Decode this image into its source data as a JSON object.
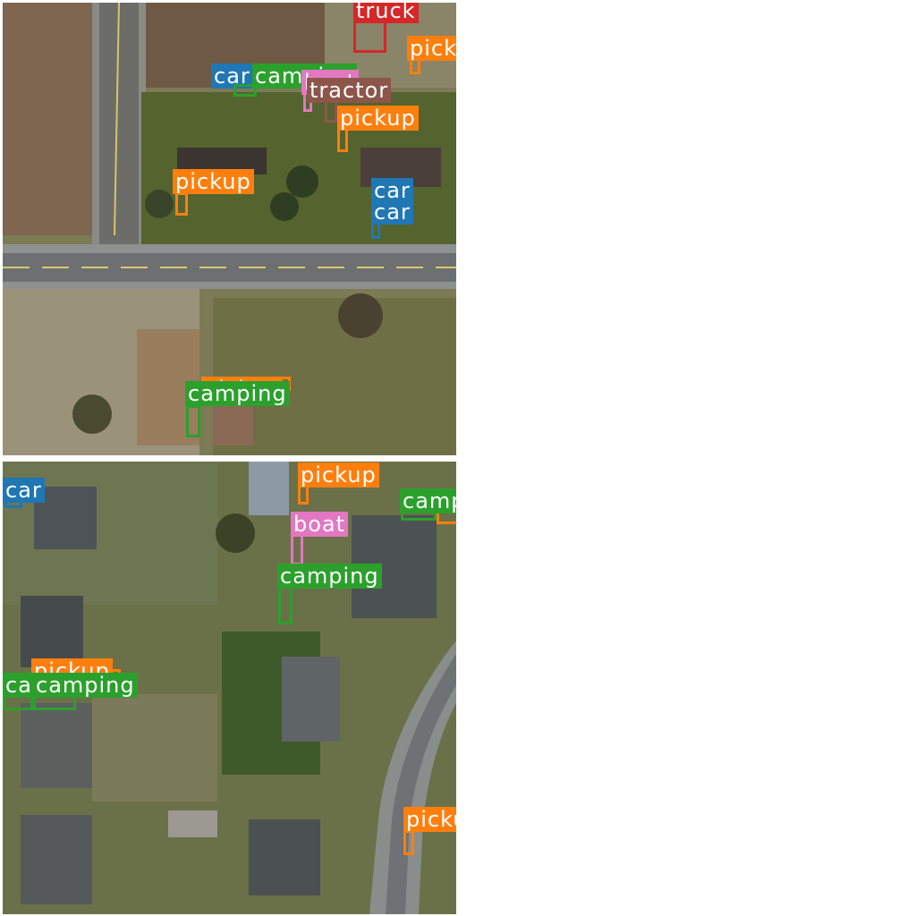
{
  "colors": {
    "car": "#1f77b4",
    "pickup": "#ff7f0e",
    "camping": "#2ca02c",
    "truck": "#d62728",
    "boat": "#e377c2",
    "tractor": "#8c564b"
  },
  "tiles": [
    {
      "name": "top",
      "detections": [
        {
          "label": "truck",
          "cls": "truck"
        },
        {
          "label": "pickup",
          "cls": "pickup"
        },
        {
          "label": "car",
          "cls": "car"
        },
        {
          "label": "camping",
          "cls": "camping"
        },
        {
          "label": "boat",
          "cls": "boat"
        },
        {
          "label": "tractor",
          "cls": "tractor"
        },
        {
          "label": "pickup",
          "cls": "pickup"
        },
        {
          "label": "pickup",
          "cls": "pickup"
        },
        {
          "label": "car",
          "cls": "car"
        },
        {
          "label": "car",
          "cls": "car"
        },
        {
          "label": "pickup",
          "cls": "pickup"
        },
        {
          "label": "camping",
          "cls": "camping"
        }
      ]
    },
    {
      "name": "bottom",
      "detections": [
        {
          "label": "car",
          "cls": "car"
        },
        {
          "label": "pickup",
          "cls": "pickup"
        },
        {
          "label": "pickup",
          "cls": "pickup"
        },
        {
          "label": "camping",
          "cls": "camping"
        },
        {
          "label": "boat",
          "cls": "boat"
        },
        {
          "label": "camping",
          "cls": "camping"
        },
        {
          "label": "pickup",
          "cls": "pickup"
        },
        {
          "label": "camping",
          "cls": "camping"
        },
        {
          "label": "camping",
          "cls": "camping"
        },
        {
          "label": "pickup",
          "cls": "pickup"
        }
      ]
    }
  ]
}
